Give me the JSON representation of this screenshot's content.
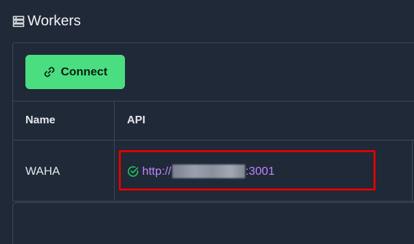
{
  "page": {
    "title": "Workers",
    "title_icon": "server-icon"
  },
  "toolbar": {
    "connect_label": "Connect",
    "connect_icon": "link-icon"
  },
  "table": {
    "columns": [
      "Name",
      "API"
    ],
    "rows": [
      {
        "name": "WAHA",
        "api_prefix": "http://",
        "api_suffix": ":3001",
        "status_icon": "check-circle-icon"
      }
    ]
  },
  "colors": {
    "background": "#1f2937",
    "accent": "#4ade80",
    "link": "#c084fc",
    "highlight": "#e00000",
    "status_ok": "#22c55e"
  }
}
